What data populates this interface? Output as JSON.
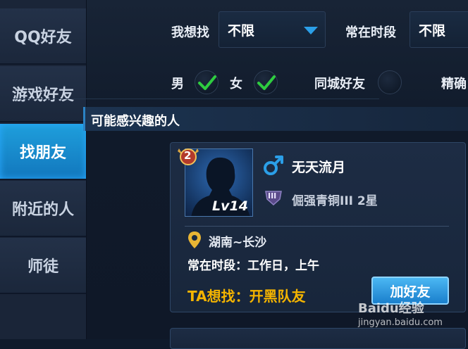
{
  "sidebar": {
    "items": [
      {
        "label": "QQ好友",
        "active": false
      },
      {
        "label": "游戏好友",
        "active": false
      },
      {
        "label": "找朋友",
        "active": true
      },
      {
        "label": "附近的人",
        "active": false
      },
      {
        "label": "师徒",
        "active": false
      }
    ]
  },
  "filters": {
    "seek_label": "我想找",
    "seek_value": "不限",
    "time_label": "常在时段",
    "time_value": "不限",
    "male_label": "男",
    "male_checked": true,
    "female_label": "女",
    "female_checked": true,
    "same_city_label": "同城好友",
    "same_city_checked": false,
    "precise_label": "精确"
  },
  "section": {
    "title": "可能感兴趣的人"
  },
  "card": {
    "rank_number": "2",
    "level": "Lv14",
    "gender_icon": "male-icon",
    "name": "无天流月",
    "rank_icon_text": "III",
    "rank": "倔强青铜III 2星",
    "location": "湖南~长沙",
    "active_time": "常在时段：工作日，上午",
    "wants": "TA想找：开黑队友",
    "add_button": "加好友"
  },
  "watermark": {
    "brand": "Baidu经验",
    "url": "jingyan.baidu.com"
  },
  "colors": {
    "accent": "#1f9fdc",
    "highlight": "#f4b400",
    "check": "#2ecc40",
    "male": "#2b9fe8"
  }
}
